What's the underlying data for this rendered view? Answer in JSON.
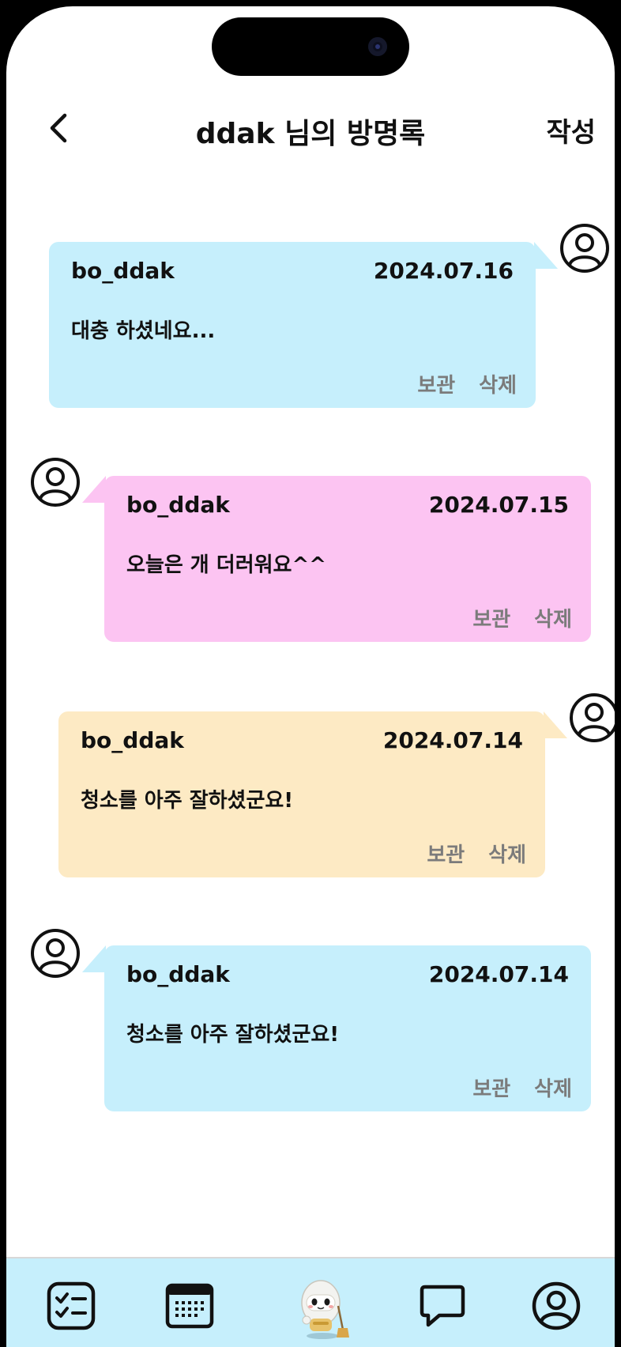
{
  "header": {
    "title": "ddak 님의 방명록",
    "write_label": "작성",
    "back_icon": "chevron-left-icon"
  },
  "colors": {
    "blue": "#c6effc",
    "pink": "#fcc4f2",
    "yellow": "#fdeac4"
  },
  "entries": [
    {
      "author": "bo_ddak",
      "date": "2024.07.16",
      "message": "대충 하셨네요...",
      "keep": "보관",
      "delete": "삭제",
      "color": "#c6effc",
      "side": "right"
    },
    {
      "author": "bo_ddak",
      "date": "2024.07.15",
      "message": "오늘은 개 더러워요^^",
      "keep": "보관",
      "delete": "삭제",
      "color": "#fcc4f2",
      "side": "left"
    },
    {
      "author": "bo_ddak",
      "date": "2024.07.14",
      "message": "청소를 아주 잘하셨군요!",
      "keep": "보관",
      "delete": "삭제",
      "color": "#fdeac4",
      "side": "right"
    },
    {
      "author": "bo_ddak",
      "date": "2024.07.14",
      "message": "청소를 아주 잘하셨군요!",
      "keep": "보관",
      "delete": "삭제",
      "color": "#c6effc",
      "side": "left"
    }
  ],
  "tabbar": {
    "items": [
      "checklist-icon",
      "calendar-icon",
      "robot-mascot-icon",
      "chat-bubble-icon",
      "profile-icon"
    ]
  }
}
